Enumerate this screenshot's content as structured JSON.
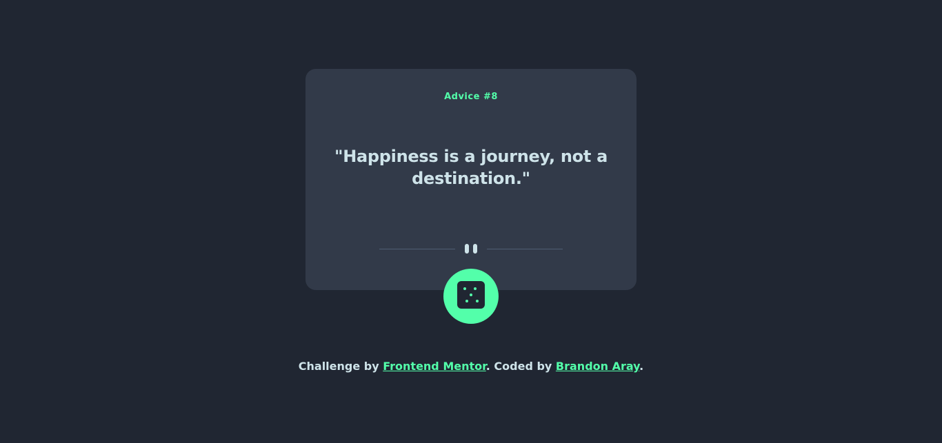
{
  "card": {
    "advice_label": "Advice #8",
    "quote": "\"Happiness is a journey, not a destination.\""
  },
  "divider": {
    "icon": "pause-icon"
  },
  "dice_button": {
    "icon": "dice-icon"
  },
  "footer": {
    "prefix": "Challenge by ",
    "challenge_link": "Frontend Mentor",
    "middle": ". Coded by ",
    "author_link": "Brandon Aray",
    "suffix": "."
  },
  "colors": {
    "background": "#202632",
    "card": "#323a49",
    "accent": "#53ffaa",
    "text": "#cee3e9",
    "divider": "#4f5d74"
  }
}
